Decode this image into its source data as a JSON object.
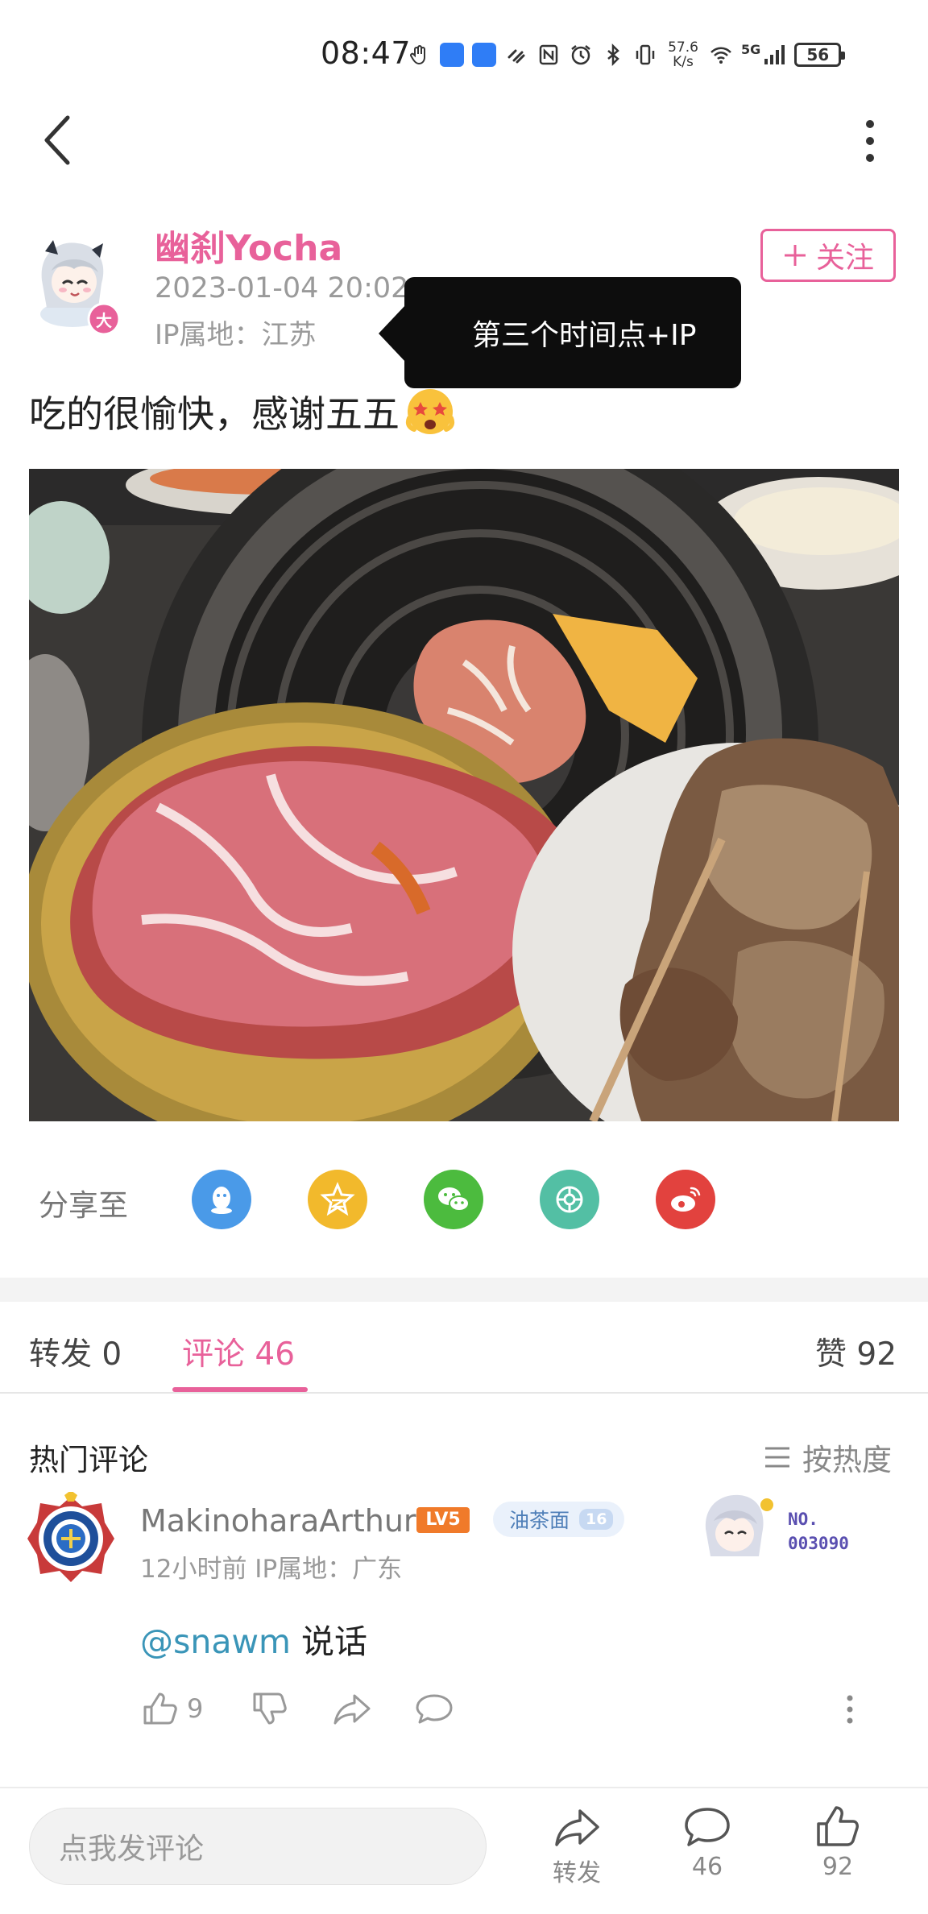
{
  "status_bar": {
    "time": "08:47",
    "net_speed_value": "57.6",
    "net_speed_unit": "K/s",
    "network": "5G",
    "battery": "56"
  },
  "author": {
    "name": "幽刹Yocha",
    "avatar_badge": "大",
    "time": "2023-01-04 20:02",
    "ip": "IP属地：江苏",
    "follow_label": "关注"
  },
  "tooltip": {
    "text": "第三个时间点+IP"
  },
  "post": {
    "text": "吃的很愉快，感谢五五"
  },
  "share": {
    "label": "分享至",
    "targets": [
      "qq-icon",
      "qzone-icon",
      "wechat-icon",
      "moments-icon",
      "weibo-icon"
    ],
    "colors": {
      "qq": "#4a9ae8",
      "qzone": "#f2b92c",
      "wechat": "#4cbb3e",
      "moments": "#53bfa4",
      "weibo": "#e2423e"
    }
  },
  "tabs": {
    "repost": "转发 0",
    "comments": "评论 46",
    "likes": "赞 92"
  },
  "comments_section": {
    "title": "热门评论",
    "sort_label": "按热度"
  },
  "comment": {
    "user": "MakinoharaArthur",
    "level": "LV5",
    "fan_badge": "油茶面",
    "fan_level": "16",
    "card_no_label": "NO.",
    "card_no": "003090",
    "meta": "12小时前  IP属地：广东",
    "mention": "@snawm",
    "text": " 说话",
    "like_count": "9"
  },
  "bottom_bar": {
    "input_placeholder": "点我发评论",
    "repost_label": "转发",
    "comments_count": "46",
    "likes_count": "92"
  },
  "colors": {
    "accent_pink": "#e8619a",
    "mention_blue": "#3a95b8",
    "level_orange": "#f07a2a"
  }
}
